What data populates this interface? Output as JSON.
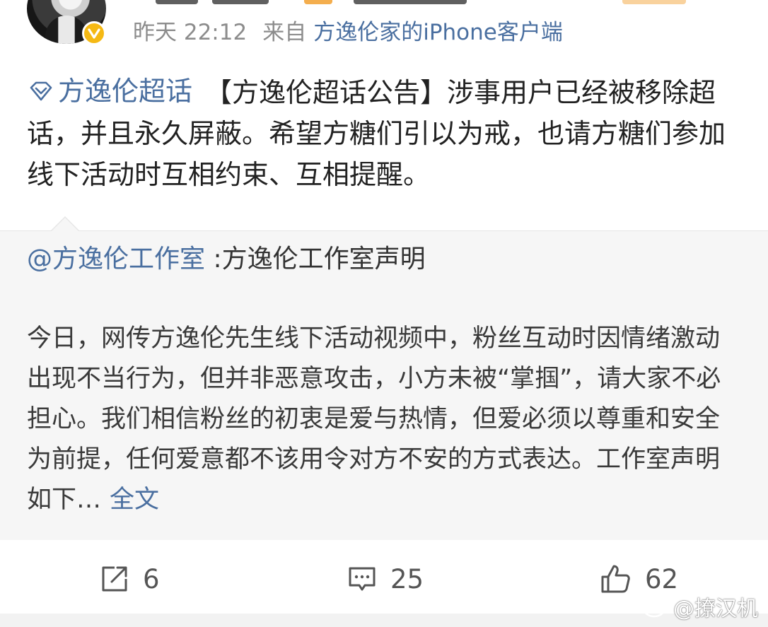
{
  "header": {
    "time": "昨天 22:12",
    "source_prefix": "来自",
    "source_client": "方逸伦家的iPhone客户端"
  },
  "post": {
    "topic_name": "方逸伦超话",
    "text": "【方逸伦超话公告】涉事用户已经被移除超话，并且永久屏蔽。希望方糖们引以为戒，也请方糖们参加线下活动时互相约束、互相提醒。"
  },
  "repost": {
    "mention": "@方逸伦工作室",
    "title": " :方逸伦工作室声明",
    "body": "今日，网传方逸伦先生线下活动视频中，粉丝互动时因情绪激动出现不当行为，但并非恶意攻击，小方未被“掌掴”，请大家不必担心。我们相信粉丝的初衷是爱与热情，但爱必须以尊重和安全为前提，任何爱意都不该用令对方不安的方式表达。工作室声明如下…",
    "expand_label": "全文"
  },
  "actions": {
    "repost_count": "6",
    "comment_count": "25",
    "like_count": "62"
  },
  "watermark": {
    "text": "@撩汉机"
  },
  "colors": {
    "link": "#4a6fa0",
    "meta": "#8c8c8c",
    "verify_badge": "#f5b914",
    "card_background": "#f6f6f6"
  },
  "icons": {
    "verify": "verified-badge-icon",
    "topic": "super-topic-diamond-icon",
    "repost": "repost-icon",
    "comment": "comment-icon",
    "like": "thumbs-up-icon",
    "watermark": "weibo-logo-icon"
  }
}
